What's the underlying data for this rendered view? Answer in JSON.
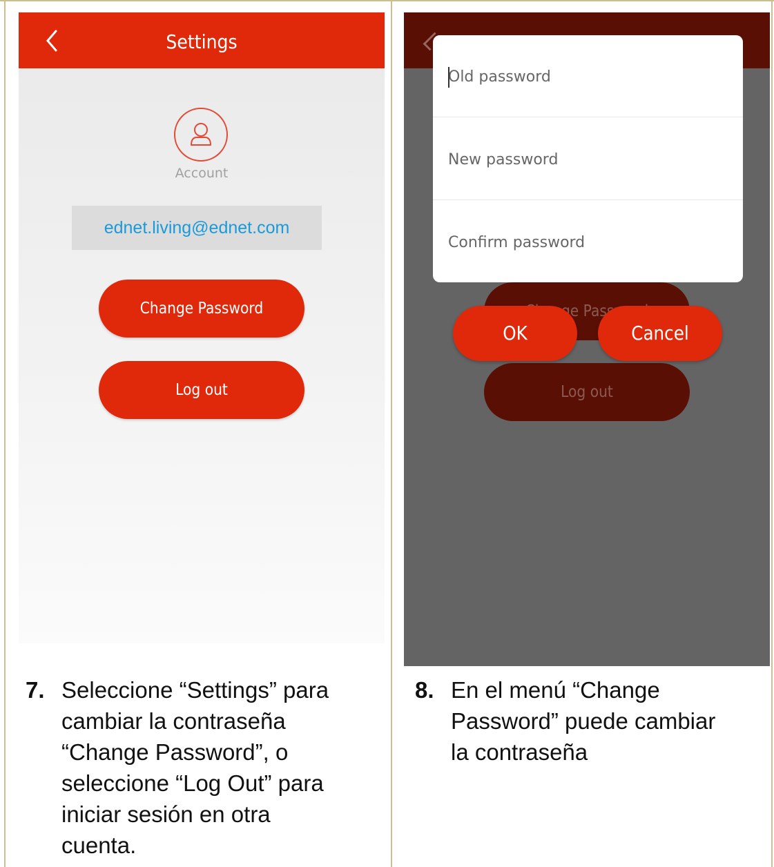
{
  "left_screen": {
    "header_title": "Settings",
    "account_label": "Account",
    "email": "ednet.living@ednet.com",
    "change_password_label": "Change Password",
    "log_out_label": "Log out",
    "icons": [
      "chevron-left-icon",
      "user-icon"
    ]
  },
  "right_screen": {
    "dialog": {
      "old_password_placeholder": "Old password",
      "new_password_placeholder": "New password",
      "confirm_password_placeholder": "Confirm password",
      "ok_label": "OK",
      "cancel_label": "Cancel"
    },
    "background_change_password_label": "Change Password",
    "background_log_out_label": "Log out"
  },
  "captions": {
    "step7_number": "7.",
    "step7_text": "Seleccione “Settings” para\ncambiar la contraseña\n“Change Password”, o\nseleccione “Log Out” para\niniciar sesión en otra\ncuenta.",
    "step8_number": "8.",
    "step8_text": "En el menú “Change\nPassword” puede cambiar\nla contraseña"
  },
  "colors": {
    "accent_red": "#e0290a",
    "dark_red_overlay": "#5a0f04",
    "email_blue": "#1a9ad9",
    "border": "#cbbf92"
  }
}
